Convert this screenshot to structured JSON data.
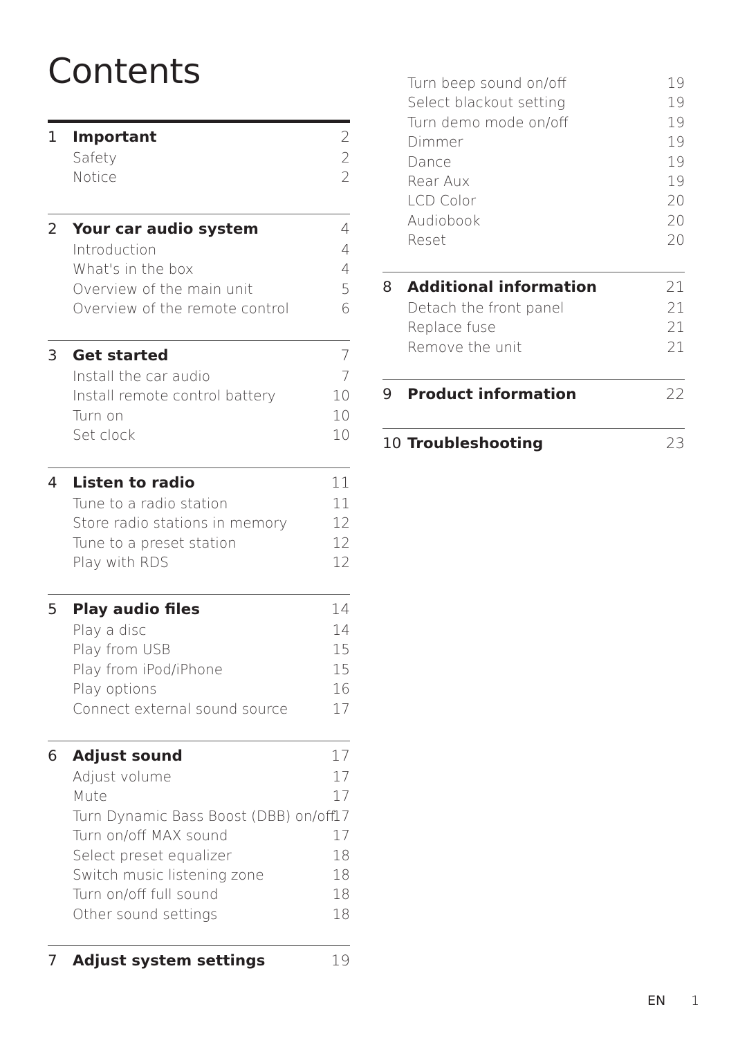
{
  "title": "Contents",
  "left_sections": [
    {
      "number": "1",
      "title": "Important",
      "page": "2",
      "items": [
        {
          "label": "Safety",
          "page": "2"
        },
        {
          "label": "Notice",
          "page": "2"
        }
      ]
    },
    {
      "number": "2",
      "title": "Your car audio system",
      "page": "4",
      "items": [
        {
          "label": "Introduction",
          "page": "4"
        },
        {
          "label": "What's in the box",
          "page": "4"
        },
        {
          "label": "Overview of the main unit",
          "page": "5"
        },
        {
          "label": "Overview of the remote control",
          "page": "6"
        }
      ]
    },
    {
      "number": "3",
      "title": "Get started",
      "page": "7",
      "items": [
        {
          "label": "Install the car audio",
          "page": "7"
        },
        {
          "label": "Install remote control battery",
          "page": "10"
        },
        {
          "label": "Turn on",
          "page": "10"
        },
        {
          "label": "Set clock",
          "page": "10"
        }
      ]
    },
    {
      "number": "4",
      "title": "Listen to radio",
      "page": "11",
      "items": [
        {
          "label": "Tune to a radio station",
          "page": "11"
        },
        {
          "label": "Store radio stations in memory",
          "page": "12"
        },
        {
          "label": "Tune to a preset station",
          "page": "12"
        },
        {
          "label": "Play with RDS",
          "page": "12"
        }
      ]
    },
    {
      "number": "5",
      "title": "Play audio files",
      "page": "14",
      "items": [
        {
          "label": "Play a disc",
          "page": "14"
        },
        {
          "label": "Play from USB",
          "page": "15"
        },
        {
          "label": "Play from iPod/iPhone",
          "page": "15"
        },
        {
          "label": "Play options",
          "page": "16"
        },
        {
          "label": "Connect external sound source",
          "page": "17"
        }
      ]
    },
    {
      "number": "6",
      "title": "Adjust sound",
      "page": "17",
      "items": [
        {
          "label": "Adjust volume",
          "page": "17"
        },
        {
          "label": "Mute",
          "page": "17"
        },
        {
          "label": "Turn Dynamic Bass Boost (DBB) on/off",
          "page": "17"
        },
        {
          "label": "Turn on/off MAX sound",
          "page": "17"
        },
        {
          "label": "Select preset equalizer",
          "page": "18"
        },
        {
          "label": "Switch music listening zone",
          "page": "18"
        },
        {
          "label": "Turn on/off full sound",
          "page": "18"
        },
        {
          "label": "Other sound settings",
          "page": "18"
        }
      ]
    },
    {
      "number": "7",
      "title": "Adjust system settings",
      "page": "19",
      "items": []
    }
  ],
  "right_continuation": [
    {
      "label": "Turn beep sound on/off",
      "page": "19"
    },
    {
      "label": "Select blackout setting",
      "page": "19"
    },
    {
      "label": "Turn demo mode on/off",
      "page": "19"
    },
    {
      "label": "Dimmer",
      "page": "19"
    },
    {
      "label": "Dance",
      "page": "19"
    },
    {
      "label": "Rear Aux",
      "page": "19"
    },
    {
      "label": "LCD Color",
      "page": "20"
    },
    {
      "label": "Audiobook",
      "page": "20"
    },
    {
      "label": "Reset",
      "page": "20"
    }
  ],
  "right_sections": [
    {
      "number": "8",
      "title": "Additional information",
      "page": "21",
      "items": [
        {
          "label": "Detach the front panel",
          "page": "21"
        },
        {
          "label": "Replace fuse",
          "page": "21"
        },
        {
          "label": "Remove the unit",
          "page": "21"
        }
      ]
    },
    {
      "number": "9",
      "title": "Product information",
      "page": "22",
      "items": []
    },
    {
      "number": "10",
      "title": "Troubleshooting",
      "page": "23",
      "items": []
    }
  ],
  "footer": {
    "language": "EN",
    "page_number": "1"
  }
}
